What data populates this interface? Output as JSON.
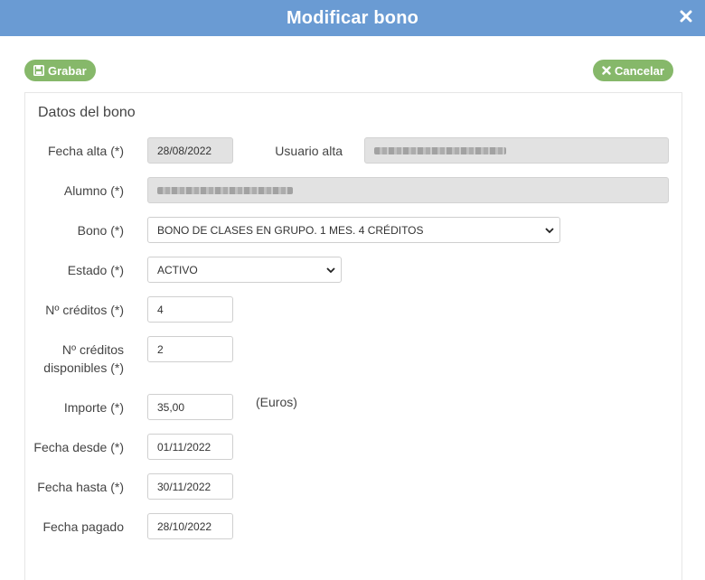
{
  "dialog": {
    "title": "Modificar bono"
  },
  "toolbar": {
    "save_label": "Grabar",
    "cancel_label": "Cancelar"
  },
  "form": {
    "section_title": "Datos del bono",
    "fecha_alta": {
      "label": "Fecha alta (*)",
      "value": "28/08/2022"
    },
    "usuario_alta": {
      "label": "Usuario alta"
    },
    "alumno": {
      "label": "Alumno (*)"
    },
    "bono": {
      "label": "Bono (*)",
      "value": "BONO DE CLASES EN GRUPO. 1 MES. 4 CRÉDITOS"
    },
    "estado": {
      "label": "Estado (*)",
      "value": "ACTIVO"
    },
    "creditos": {
      "label": "Nº créditos (*)",
      "value": "4"
    },
    "creditos_disp": {
      "label_line1": "Nº créditos",
      "label_line2": "disponibles (*)",
      "value": "2"
    },
    "importe": {
      "label": "Importe (*)",
      "value": "35,00",
      "unit": "(Euros)"
    },
    "fecha_desde": {
      "label": "Fecha desde (*)",
      "value": "01/11/2022"
    },
    "fecha_hasta": {
      "label": "Fecha hasta (*)",
      "value": "30/11/2022"
    },
    "fecha_pagado": {
      "label": "Fecha pagado",
      "value": "28/10/2022"
    }
  },
  "colors": {
    "titlebar": "#6a9bd3",
    "button": "#86b86a",
    "readonly": "#e2e2e2"
  }
}
